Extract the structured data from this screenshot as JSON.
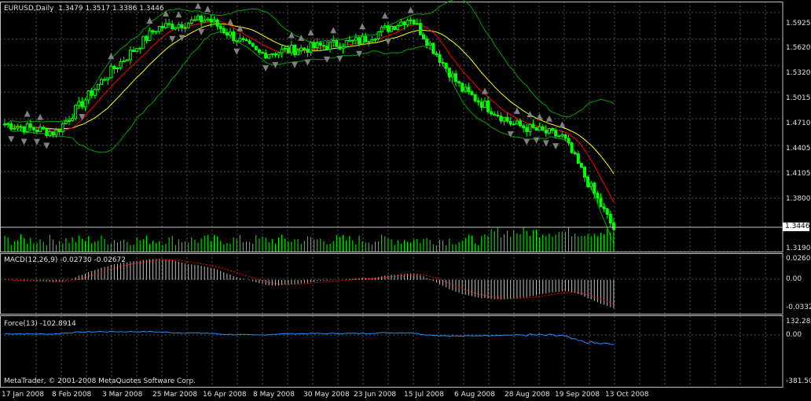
{
  "main_panel": {
    "symbol_label": "EURUSD,Daily",
    "ohlc_text": "1.3479 1.3517 1.3386 1.3446",
    "price_axis": [
      "1.5925",
      "1.5620",
      "1.5320",
      "1.5015",
      "1.4710",
      "1.4405",
      "1.4105",
      "1.3800",
      "1.3190"
    ],
    "current_price": "1.3446"
  },
  "macd_panel": {
    "label": "MACD(12,26,9) -0.02730 -0.02672",
    "axis": [
      "0.02604",
      "0.00",
      "-0.0332"
    ]
  },
  "force_panel": {
    "label": "Force(13) -102.8914",
    "axis": [
      "132.284",
      "0.00",
      "-381.501"
    ]
  },
  "copyright": "MetaTrader, © 2001-2008 MetaQuotes Software Corp.",
  "date_axis": [
    "17 Jan 2008",
    "8 Feb 2008",
    "3 Mar 2008",
    "25 Mar 2008",
    "16 Apr 2008",
    "8 May 2008",
    "30 May 2008",
    "23 Jun 2008",
    "15 Jul 2008",
    "6 Aug 2008",
    "28 Aug 2008",
    "19 Sep 2008",
    "13 Oct 2008"
  ],
  "colors": {
    "candle": "#00ff00",
    "volume": "#00ff00",
    "ma_red": "#ff0000",
    "ma_yellow": "#ffff00",
    "bands": "#00a000",
    "macd_hist": "#c0c0c0",
    "macd_signal": "#ff0000",
    "force_line": "#1e90ff",
    "grid": "#505050"
  },
  "chart_data": {
    "type": "candlestick",
    "instrument": "EURUSD",
    "timeframe": "Daily",
    "ohlc_last": {
      "open": 1.3479,
      "high": 1.3517,
      "low": 1.3386,
      "close": 1.3446
    },
    "close_path": [
      [
        "17 Jan 2008",
        1.465
      ],
      [
        "8 Feb 2008",
        1.455
      ],
      [
        "3 Mar 2008",
        1.52
      ],
      [
        "25 Mar 2008",
        1.575
      ],
      [
        "16 Apr 2008",
        1.585
      ],
      [
        "8 May 2008",
        1.545
      ],
      [
        "30 May 2008",
        1.552
      ],
      [
        "23 Jun 2008",
        1.56
      ],
      [
        "15 Jul 2008",
        1.587
      ],
      [
        "6 Aug 2008",
        1.505
      ],
      [
        "28 Aug 2008",
        1.465
      ],
      [
        "19 Sep 2008",
        1.45
      ],
      [
        "13 Oct 2008",
        1.345
      ]
    ],
    "ylim": [
      1.319,
      1.605
    ],
    "macd": {
      "main": -0.0273,
      "signal": -0.02672,
      "ylim": [
        -0.0332,
        0.02604
      ]
    },
    "force": {
      "value": -102.8914,
      "ylim": [
        -381.501,
        132.284
      ]
    }
  }
}
